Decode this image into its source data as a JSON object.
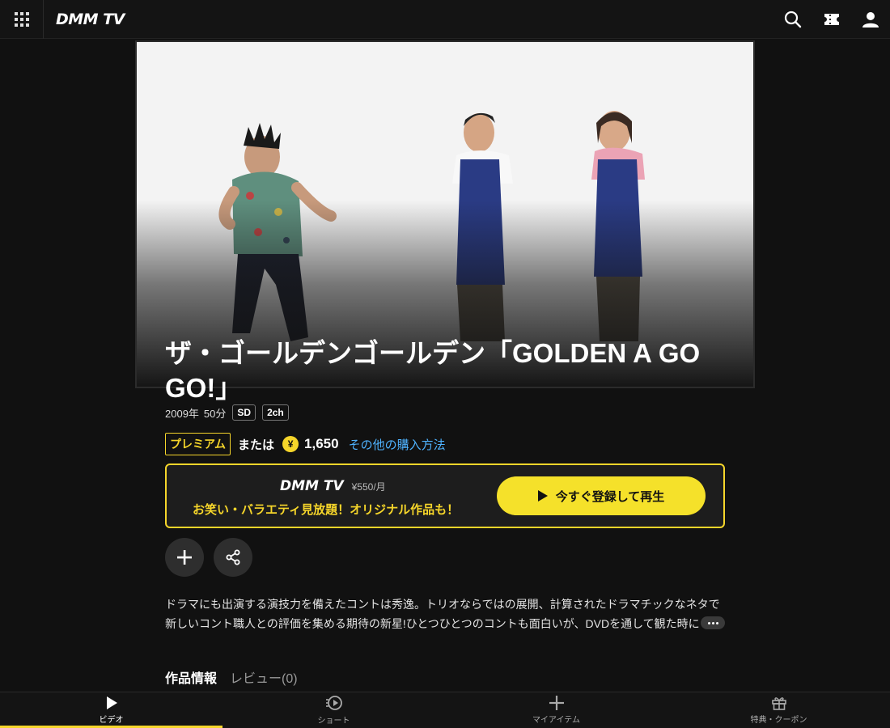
{
  "header": {
    "logo_text": "DMM TV",
    "icons": [
      "grid-menu-icon",
      "search-icon",
      "ticket-icon",
      "user-icon"
    ]
  },
  "content": {
    "title": "ザ・ゴールデンゴールデン「GOLDEN A GO GO!」",
    "year": "2009年",
    "duration": "50分",
    "tags": [
      "SD",
      "2ch"
    ],
    "premium_label": "プレミアム",
    "or_label": "または",
    "price": "1,650",
    "other_purchase_link": "その他の購入方法"
  },
  "promo": {
    "brand": "DMM TV",
    "monthly_price": "¥550/月",
    "tagline": "お笑い・バラエティ見放題！オリジナル作品も！",
    "cta_label": "今すぐ登録して再生"
  },
  "description": {
    "line1": "ドラマにも出演する演技力を備えたコントは秀逸。トリオならではの展開、計算されたドラマチックなネタで",
    "line2": "新しいコント職人との評価を集める期待の新星!ひとつひとつのコントも面白いが、DVDを通して観た時に"
  },
  "tabs": [
    {
      "label": "作品情報",
      "active": true
    },
    {
      "label": "レビュー(0)",
      "active": false
    }
  ],
  "bottom_nav": [
    {
      "label": "ビデオ",
      "icon": "play-icon",
      "active": true
    },
    {
      "label": "ショート",
      "icon": "short-video-icon",
      "active": false
    },
    {
      "label": "マイアイテム",
      "icon": "plus-icon",
      "active": false
    },
    {
      "label": "特典・クーポン",
      "icon": "gift-icon",
      "active": false
    }
  ],
  "colors": {
    "accent": "#f5d52a",
    "cta": "#f5e12a",
    "link": "#4fb3ff",
    "background": "#111111"
  }
}
